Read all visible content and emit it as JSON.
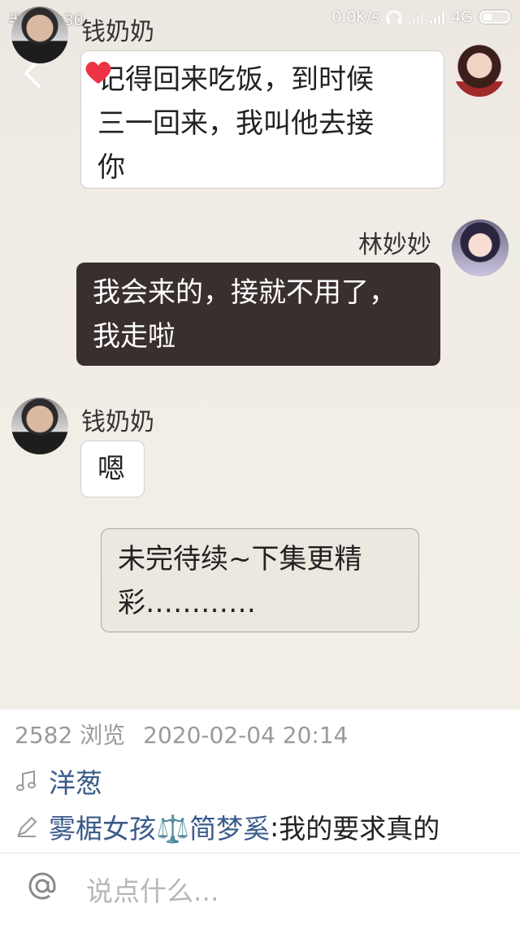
{
  "status_bar": {
    "time": "半夜12:30",
    "net_speed": "0.0K/s",
    "network": "4G"
  },
  "messages": [
    {
      "sender": "钱奶奶",
      "text_lines": [
        "记得回来吃饭，到时候",
        "三一回来，我叫他去接",
        "你"
      ]
    },
    {
      "sender": "林妙妙",
      "text_lines": [
        "我会来的，接就不用了，",
        "我走啦"
      ]
    },
    {
      "sender": "钱奶奶",
      "text_lines": [
        "嗯"
      ]
    }
  ],
  "note": {
    "text_lines": [
      "未完待续~下集更精",
      "彩…………"
    ]
  },
  "stats": {
    "views": "2582 浏览",
    "datetime": "2020-02-04 20:14"
  },
  "music": {
    "title": "洋葱"
  },
  "comment": {
    "author": "雾椐女孩⚖️简梦奚",
    "separator": ": ",
    "text": "我的要求真的"
  },
  "input": {
    "at": "@",
    "placeholder": "说点什么..."
  },
  "icons": {
    "back": "chevron-left-icon",
    "heart": "heart-icon",
    "music": "music-note-icon",
    "edit": "pencil-icon",
    "mention": "at-icon"
  },
  "colors": {
    "dark_bubble": "#3a2f2f",
    "link": "#3b5b8a",
    "heart": "#ee3344"
  }
}
